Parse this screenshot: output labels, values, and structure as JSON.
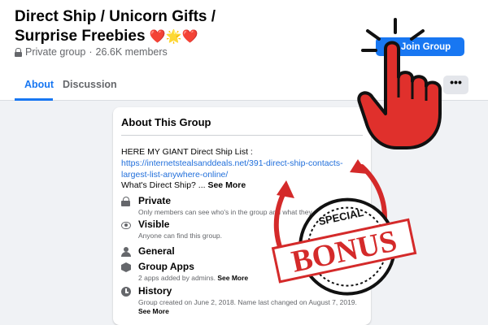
{
  "group": {
    "title": "Direct Ship / Unicorn Gifts / Surprise Freebies",
    "title_emoji": "❤️🌟❤️",
    "privacy": "Private group",
    "members": "26.6K members"
  },
  "actions": {
    "join_label": "Join Group",
    "join_icon": "person-plus-icon",
    "more_label": "•••"
  },
  "tabs": [
    {
      "label": "About",
      "active": true
    },
    {
      "label": "Discussion",
      "active": false
    }
  ],
  "about": {
    "title": "About This Group",
    "description_line": "HERE MY GIANT Direct Ship List :",
    "link": "https://internetstealsanddeals.net/391-direct-ship-contacts-largest-list-anywhere-online/",
    "whats_prefix": "What's Direct Ship? ...",
    "see_more": "See More",
    "items": [
      {
        "icon": "lock-icon",
        "label": "Private",
        "sub": "Only members can see who's in the group and what they post."
      },
      {
        "icon": "eye-icon",
        "label": "Visible",
        "sub": "Anyone can find this group."
      },
      {
        "icon": "people-icon",
        "label": "General",
        "sub": ""
      },
      {
        "icon": "cube-icon",
        "label": "Group Apps",
        "sub": "2 apps added by admins.",
        "sub_link": "See More"
      },
      {
        "icon": "clock-icon",
        "label": "History",
        "sub": "Group created on June 2, 2018. Name last changed on August 7, 2019.",
        "sub_link": "See More"
      }
    ]
  },
  "overlay": {
    "stamp_top": "SPECIAL",
    "stamp_main": "BONUS",
    "colors": {
      "red": "#d42a2a",
      "blue": "#1877f2"
    }
  }
}
